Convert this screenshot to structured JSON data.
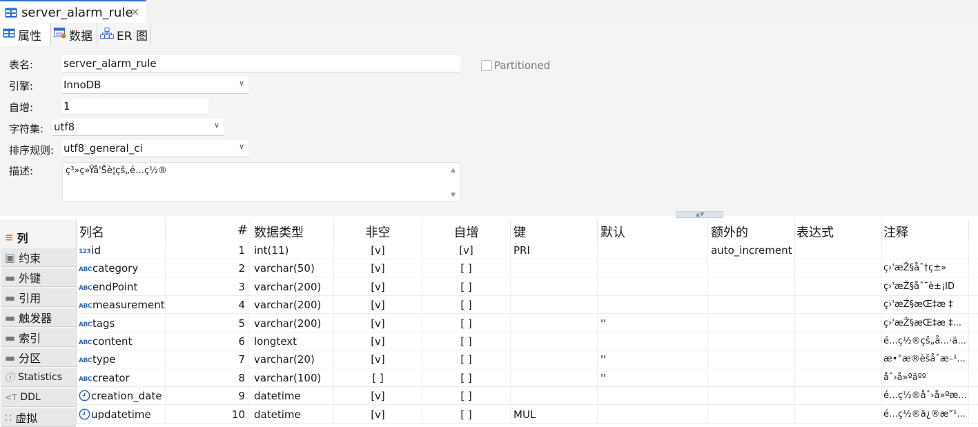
{
  "editor_tab": {
    "title": "server_alarm_rule",
    "close": "✕"
  },
  "sub_tabs": [
    {
      "label": "属性"
    },
    {
      "label": "数据"
    },
    {
      "label": "ER 图"
    }
  ],
  "form": {
    "table_name_label": "表名:",
    "table_name": "server_alarm_rule",
    "engine_label": "引擎:",
    "engine": "InnoDB",
    "autoinc_label": "自增:",
    "autoinc": "1",
    "charset_label": "字符集:",
    "charset": "utf8",
    "collation_label": "排序规则:",
    "collation": "utf8_general_ci",
    "desc_label": "描述:",
    "desc": "ç³»ç»Ÿå'Šè­¦çš„é…ç½®",
    "partitioned_label": "Partitioned",
    "partitioned": false
  },
  "sidebar": [
    {
      "label": "列"
    },
    {
      "label": "约束"
    },
    {
      "label": "外键"
    },
    {
      "label": "引用"
    },
    {
      "label": "触发器"
    },
    {
      "label": "索引"
    },
    {
      "label": "分区"
    },
    {
      "label": "Statistics"
    },
    {
      "label": "DDL"
    },
    {
      "label": "虚拟"
    }
  ],
  "columns_header": [
    "列名",
    "#",
    "数据类型",
    "非空",
    "自增",
    "键",
    "默认",
    "额外的",
    "表达式",
    "注释"
  ],
  "rows": [
    {
      "icon": "123",
      "name": "id",
      "num": "1",
      "type": "int(11)",
      "notnull": "[v]",
      "autoinc": "[v]",
      "key": "PRI",
      "default": "",
      "extra": "auto_increment",
      "expr": "",
      "comment": ""
    },
    {
      "icon": "ABC",
      "name": "category",
      "num": "2",
      "type": "varchar(50)",
      "notnull": "[v]",
      "autoinc": "[ ]",
      "key": "",
      "default": "",
      "extra": "",
      "expr": "",
      "comment": "ç›'æŽ§åˆ†ç±»"
    },
    {
      "icon": "ABC",
      "name": "endPoint",
      "num": "3",
      "type": "varchar(200)",
      "notnull": "[v]",
      "autoinc": "[ ]",
      "key": "",
      "default": "",
      "extra": "",
      "expr": "",
      "comment": "ç›'æŽ§åˆ¯è±¡ID"
    },
    {
      "icon": "ABC",
      "name": "measurement",
      "num": "4",
      "type": "varchar(200)",
      "notnull": "[v]",
      "autoinc": "[ ]",
      "key": "",
      "default": "",
      "extra": "",
      "expr": "",
      "comment": "ç›'æŽ§æŒ‡æ ‡"
    },
    {
      "icon": "ABC",
      "name": "tags",
      "num": "5",
      "type": "varchar(200)",
      "notnull": "[v]",
      "autoinc": "[ ]",
      "key": "",
      "default": "''",
      "extra": "",
      "expr": "",
      "comment": "ç›'æŽ§æŒ‡æ ‡..."
    },
    {
      "icon": "ABC",
      "name": "content",
      "num": "6",
      "type": "longtext",
      "notnull": "[v]",
      "autoinc": "[ ]",
      "key": "",
      "default": "",
      "extra": "",
      "expr": "",
      "comment": "é…ç½®çš„å…·ä..."
    },
    {
      "icon": "ABC",
      "name": "type",
      "num": "7",
      "type": "varchar(20)",
      "notnull": "[v]",
      "autoinc": "[ ]",
      "key": "",
      "default": "''",
      "extra": "",
      "expr": "",
      "comment": "æ•°æ®èšåˆæ–¹..."
    },
    {
      "icon": "ABC",
      "name": "creator",
      "num": "8",
      "type": "varchar(100)",
      "notnull": "[ ]",
      "autoinc": "[ ]",
      "key": "",
      "default": "''",
      "extra": "",
      "expr": "",
      "comment": "åˆ›å»ºäºº"
    },
    {
      "icon": "clock",
      "name": "creation_date",
      "num": "9",
      "type": "datetime",
      "notnull": "[v]",
      "autoinc": "[ ]",
      "key": "",
      "default": "",
      "extra": "",
      "expr": "",
      "comment": "é…ç½®åˆ›å»ºæ..."
    },
    {
      "icon": "clock",
      "name": "updatetime",
      "num": "10",
      "type": "datetime",
      "notnull": "[v]",
      "autoinc": "[ ]",
      "key": "MUL",
      "default": "",
      "extra": "",
      "expr": "",
      "comment": "é…ç½®ä¿®æ”¹..."
    }
  ],
  "colors": {
    "accent": "#2f6fd1",
    "icon_blue": "#2b6cc4"
  }
}
